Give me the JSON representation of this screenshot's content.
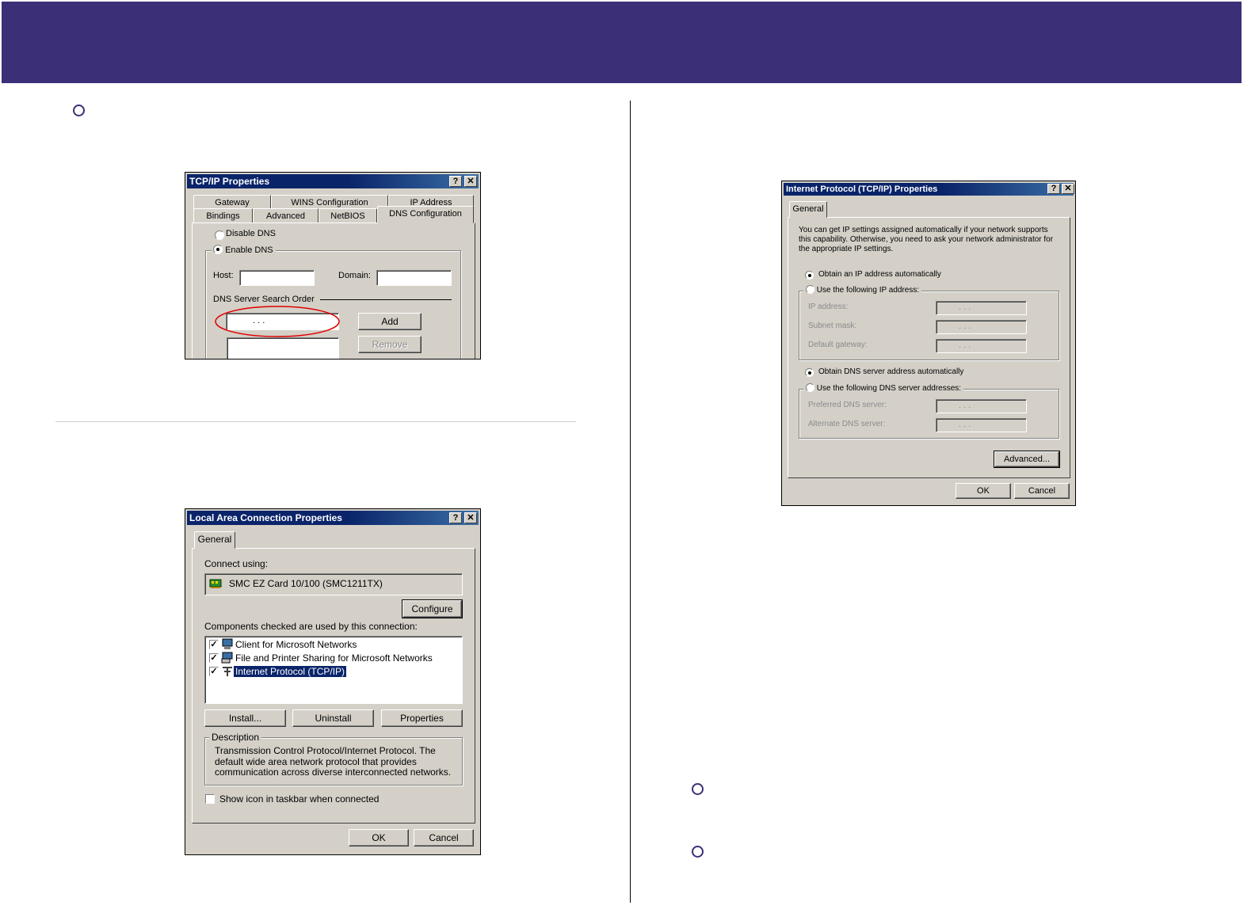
{
  "tcpip_dialog": {
    "title": "TCP/IP Properties",
    "help_btn": "?",
    "close_btn": "✕",
    "tabs_row1": [
      "Gateway",
      "WINS Configuration",
      "IP Address"
    ],
    "tabs_row2": [
      "Bindings",
      "Advanced",
      "NetBIOS",
      "DNS Configuration"
    ],
    "disable_dns": "Disable DNS",
    "enable_dns": "Enable DNS",
    "host_label": "Host:",
    "domain_label": "Domain:",
    "search_order_label": "DNS Server Search Order",
    "ip_dots": ".       .       .",
    "add_btn": "Add",
    "remove_btn": "Remove"
  },
  "lan_dialog": {
    "title": "Local Area Connection Properties",
    "help_btn": "?",
    "close_btn": "✕",
    "tab": "General",
    "connect_using": "Connect using:",
    "adapter": "SMC EZ Card 10/100 (SMC1211TX)",
    "configure_btn": "Configure",
    "components_label": "Components checked are used by this connection:",
    "components": [
      {
        "label": "Client for Microsoft Networks",
        "checked": true
      },
      {
        "label": "File and Printer Sharing for Microsoft Networks",
        "checked": true
      },
      {
        "label": "Internet Protocol (TCP/IP)",
        "checked": true,
        "selected": true
      }
    ],
    "install_btn": "Install...",
    "uninstall_btn": "Uninstall",
    "properties_btn": "Properties",
    "description_label": "Description",
    "description_text": "Transmission Control Protocol/Internet Protocol. The default wide area network protocol that provides communication across diverse interconnected networks.",
    "show_icon": "Show icon in taskbar when connected",
    "ok_btn": "OK",
    "cancel_btn": "Cancel"
  },
  "ip_dialog": {
    "title": "Internet Protocol (TCP/IP) Properties",
    "help_btn": "?",
    "close_btn": "✕",
    "tab": "General",
    "intro": "You can get IP settings assigned automatically if your network supports this capability. Otherwise, you need to ask your network administrator for the appropriate IP settings.",
    "obtain_ip": "Obtain an IP address automatically",
    "use_ip": "Use the following IP address:",
    "ip_address": "IP address:",
    "subnet_mask": "Subnet mask:",
    "default_gateway": "Default gateway:",
    "obtain_dns": "Obtain DNS server address automatically",
    "use_dns": "Use the following DNS server addresses:",
    "preferred_dns": "Preferred DNS server:",
    "alternate_dns": "Alternate DNS server:",
    "ip_dots": ".       .       .",
    "advanced_btn": "Advanced...",
    "ok_btn": "OK",
    "cancel_btn": "Cancel"
  },
  "colors": {
    "banner": "#3b3078",
    "dialog_face": "#d4d0c8",
    "titlebar": "#0a246a",
    "highlight_ellipse": "#e00000"
  }
}
